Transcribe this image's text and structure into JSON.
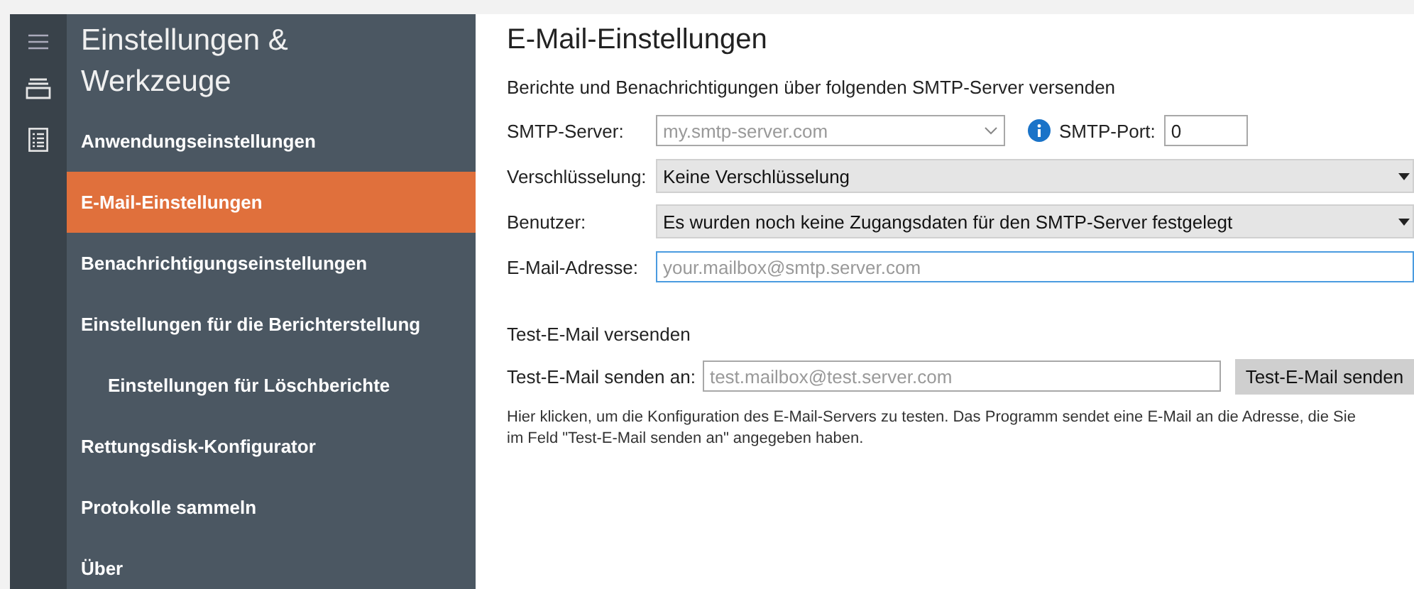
{
  "rail": {
    "items": [
      {
        "kind": "menu"
      },
      {
        "kind": "drives"
      },
      {
        "kind": "log"
      }
    ]
  },
  "sidebar": {
    "title": "Einstellungen & Werkzeuge",
    "items": [
      {
        "label": "Anwendungseinstellungen",
        "selected": false
      },
      {
        "label": "E-Mail-Einstellungen",
        "selected": true
      },
      {
        "label": "Benachrichtigungseinstellungen",
        "selected": false
      },
      {
        "label": "Einstellungen für die Berichterstellung",
        "selected": false,
        "children": [
          {
            "label": "Einstellungen für Löschberichte",
            "selected": false
          }
        ]
      },
      {
        "label": "Rettungsdisk-Konfigurator",
        "selected": false
      },
      {
        "label": "Protokolle sammeln",
        "selected": false
      },
      {
        "label": "Über",
        "selected": false
      }
    ]
  },
  "main": {
    "title": "E-Mail-Einstellungen",
    "intro": "Berichte und Benachrichtigungen über folgenden SMTP-Server versenden",
    "smtp_server": {
      "label": "SMTP-Server:",
      "placeholder": "my.smtp-server.com"
    },
    "smtp_port": {
      "label": "SMTP-Port:",
      "value": "0"
    },
    "encryption": {
      "label": "Verschlüsselung:",
      "value": "Keine Verschlüsselung"
    },
    "user": {
      "label": "Benutzer:",
      "value": "Es wurden noch keine Zugangsdaten für den SMTP-Server festgelegt"
    },
    "email": {
      "label": "E-Mail-Adresse:",
      "placeholder": "your.mailbox@smtp.server.com",
      "focused": true
    },
    "test": {
      "heading": "Test-E-Mail versenden",
      "label": "Test-E-Mail senden an:",
      "placeholder": "test.mailbox@test.server.com",
      "button": "Test-E-Mail senden",
      "help": "Hier klicken, um die Konfiguration des E-Mail-Servers zu testen. Das Programm sendet eine E-Mail an die Adresse, die Sie\nim Feld \"Test-E-Mail senden an\" angegeben haben."
    }
  }
}
